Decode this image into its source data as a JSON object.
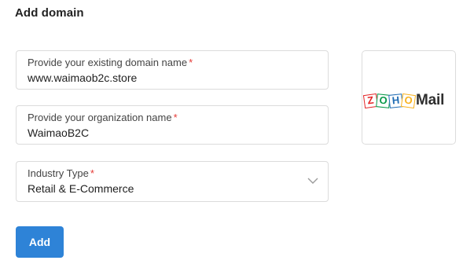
{
  "page": {
    "title": "Add domain"
  },
  "form": {
    "domain": {
      "label": "Provide your existing domain name",
      "required_mark": "*",
      "value": "www.waimaob2c.store"
    },
    "organization": {
      "label": "Provide your organization name",
      "required_mark": "*",
      "value": "WaimaoB2C"
    },
    "industry": {
      "label": "Industry Type",
      "required_mark": "*",
      "selected": "Retail & E-Commerce",
      "icon": "chevron-down-icon"
    }
  },
  "logo": {
    "tiles": [
      "Z",
      "O",
      "H",
      "O"
    ],
    "word": "Mail",
    "tile_colors": [
      "#e42527",
      "#089949",
      "#226db4",
      "#f9b21d"
    ]
  },
  "actions": {
    "add_label": "Add",
    "accent_color": "#2e83d7"
  }
}
